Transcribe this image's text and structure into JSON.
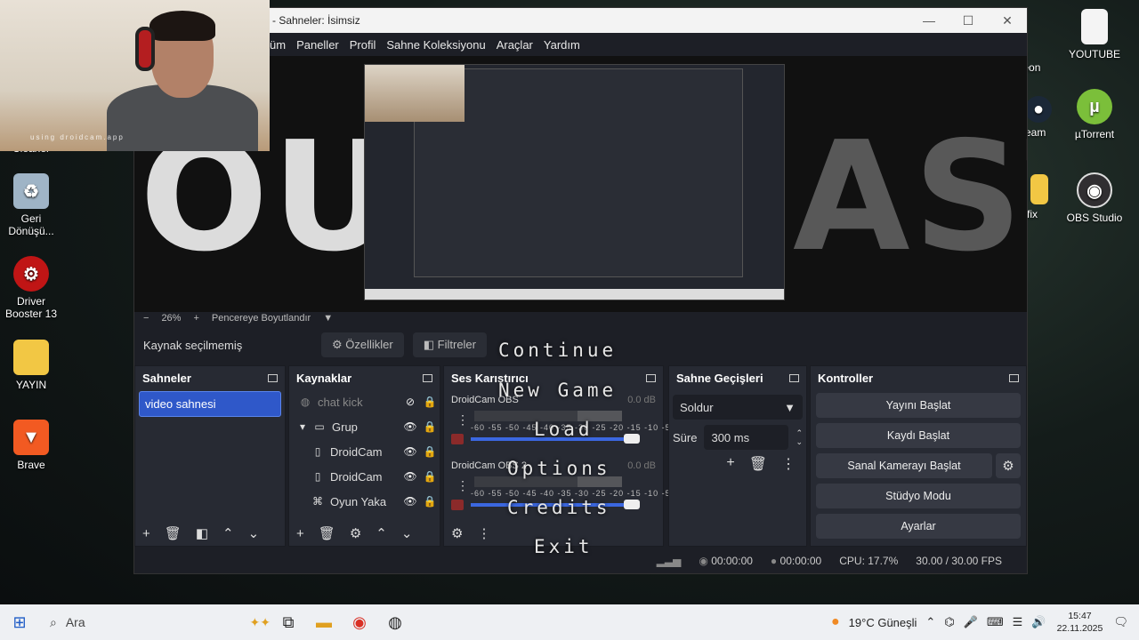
{
  "desktop": {
    "icons_left": [
      {
        "label": "Cleaner",
        "name": "ccleaner"
      },
      {
        "label": "Geri Dönüşü...",
        "name": "recycle-bin"
      },
      {
        "label": "Driver Booster 13",
        "name": "driver-booster"
      },
      {
        "label": "YAYIN",
        "name": "folder-yayin"
      },
      {
        "label": "Brave",
        "name": "brave"
      }
    ],
    "icons_right": [
      {
        "label": "ick ineon",
        "name": "kick"
      },
      {
        "label": "eam",
        "name": "steam"
      },
      {
        "label": "fix",
        "name": "fix"
      },
      {
        "label": "YOUTUBE",
        "name": "youtube"
      },
      {
        "label": "µTorrent",
        "name": "utorrent"
      },
      {
        "label": "OBS Studio",
        "name": "obs-studio"
      }
    ]
  },
  "webcam": {
    "watermark": "using droidcam.app"
  },
  "obs": {
    "title": "- Sahneler: İsimsiz",
    "menu": [
      "üm",
      "Paneller",
      "Profil",
      "Sahne Koleksiyonu",
      "Araçlar",
      "Yardım"
    ],
    "preview_text_left": "OUT",
    "preview_text_right": "AST",
    "zoom": {
      "minus": "−",
      "value": "26%",
      "plus": "+",
      "fit": "Pencereye Boyutlandır"
    },
    "source_bar": {
      "none_selected": "Kaynak seçilmemiş",
      "properties": "Özellikler",
      "filters": "Filtreler"
    },
    "scenes": {
      "title": "Sahneler",
      "items": [
        "video sahnesi"
      ]
    },
    "sources": {
      "title": "Kaynaklar",
      "items": [
        {
          "label": "chat kick",
          "icon": "globe",
          "dim": true
        },
        {
          "label": "Grup",
          "icon": "folder",
          "dim": false
        },
        {
          "label": "DroidCam",
          "icon": "file",
          "dim": false
        },
        {
          "label": "DroidCam",
          "icon": "file",
          "dim": false
        },
        {
          "label": "Oyun Yaka",
          "icon": "gamepad",
          "dim": false
        }
      ]
    },
    "mixer": {
      "title": "Ses Karıştırıcı",
      "channels": [
        {
          "name": "DroidCam OBS",
          "db": "0.0 dB"
        },
        {
          "name": "DroidCam OBS 2",
          "db": "0.0 dB"
        }
      ],
      "scale": "-60 -55 -50 -45 -40 -35 -30 -25 -20 -15 -10 -5 0"
    },
    "transitions": {
      "title": "Sahne Geçişleri",
      "selected": "Soldur",
      "duration_label": "Süre",
      "duration_value": "300 ms"
    },
    "controls": {
      "title": "Kontroller",
      "start_stream": "Yayını Başlat",
      "start_record": "Kaydı Başlat",
      "virtual_cam": "Sanal Kamerayı Başlat",
      "studio_mode": "Stüdyo Modu",
      "settings": "Ayarlar"
    },
    "status": {
      "stream_time": "00:00:00",
      "rec_time": "00:00:00",
      "cpu": "CPU: 17.7%",
      "fps": "30.00 / 30.00 FPS"
    }
  },
  "game_menu": [
    "Continue",
    "New Game",
    "Load",
    "Options",
    "Credits",
    "Exit"
  ],
  "taskbar": {
    "search_placeholder": "Ara",
    "weather": "19°C Güneşli",
    "time": "15:47",
    "date": "22.11.2025"
  }
}
